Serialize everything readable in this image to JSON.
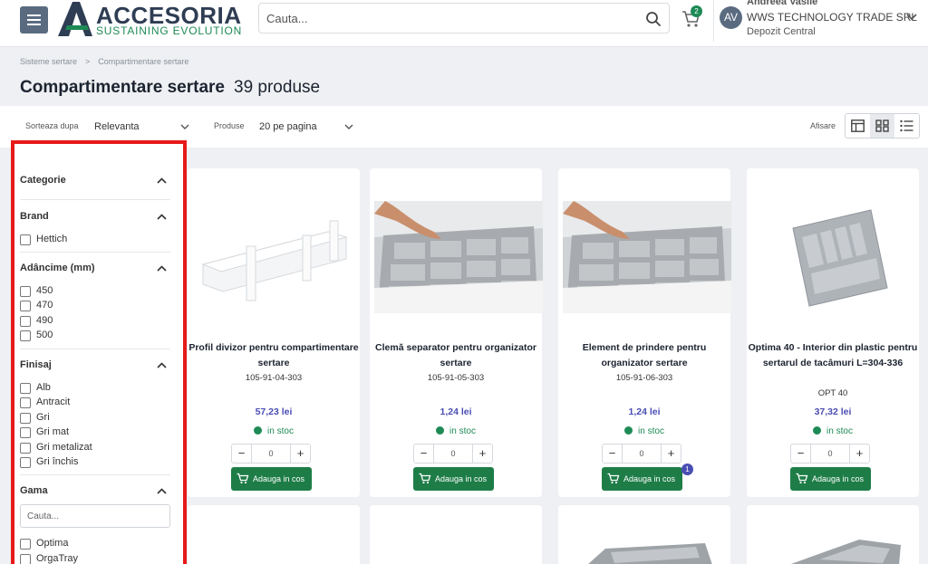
{
  "header": {
    "brand_name": "ACCESORIA",
    "brand_tagline": "SUSTAINING EVOLUTION",
    "search_placeholder": "Cauta...",
    "cart_count": "2",
    "user": {
      "initials": "AV",
      "name": "Andreea Vasile",
      "company": "WWS TECHNOLOGY TRADE SRL",
      "depot": "Depozit Central"
    }
  },
  "breadcrumb": [
    "Sisteme sertare",
    "Compartimentare sertare"
  ],
  "page": {
    "title": "Compartimentare sertare",
    "count": "39 produse"
  },
  "toolbar": {
    "sort_label": "Sorteaza dupa",
    "sort_value": "Relevanta",
    "per_page_label": "Produse",
    "per_page_value": "20 pe pagina",
    "view_label": "Afisare",
    "view_selected": "grid"
  },
  "filters": {
    "category": {
      "title": "Categorie"
    },
    "brand": {
      "title": "Brand",
      "options": [
        "Hettich"
      ]
    },
    "depth": {
      "title": "Adâncime (mm)",
      "options": [
        "450",
        "470",
        "490",
        "500"
      ]
    },
    "finish": {
      "title": "Finisaj",
      "options": [
        "Alb",
        "Antracit",
        "Gri",
        "Gri mat",
        "Gri metalizat",
        "Gri închis"
      ]
    },
    "range": {
      "title": "Gama",
      "search_placeholder": "Cauta...",
      "options": [
        "Optima",
        "OrgaTray"
      ]
    }
  },
  "products": [
    {
      "title": "Profil divizor pentru compartimentare sertare",
      "code": "105-91-04-303",
      "extra": "",
      "price": "57,23 lei",
      "stock": "in stoc",
      "qty": "0",
      "add_label": "Adauga in cos",
      "badge": ""
    },
    {
      "title": "Clemă separator pentru organizator sertare",
      "code": "105-91-05-303",
      "extra": "",
      "price": "1,24 lei",
      "stock": "in stoc",
      "qty": "0",
      "add_label": "Adauga in cos",
      "badge": ""
    },
    {
      "title": "Element de prindere pentru organizator sertare",
      "code": "105-91-06-303",
      "extra": "",
      "price": "1,24 lei",
      "stock": "in stoc",
      "qty": "0",
      "add_label": "Adauga in cos",
      "badge": "1"
    },
    {
      "title": "Optima 40 - Interior din plastic pentru sertarul de tacâmuri L=304-336",
      "code": "",
      "extra": "OPT 40",
      "price": "37,32 lei",
      "stock": "in stoc",
      "qty": "0",
      "add_label": "Adauga in cos",
      "badge": ""
    }
  ],
  "colors": {
    "brand_green": "#1e7d47",
    "price_purple": "#4a4eb3",
    "highlight_red": "#e61a1a",
    "menu_slate": "#5a6b80"
  }
}
